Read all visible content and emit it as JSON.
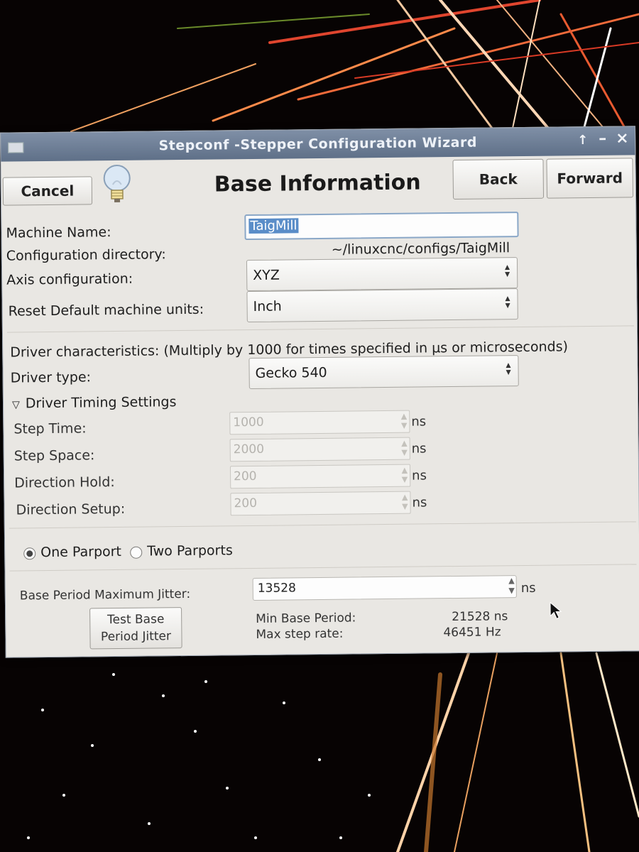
{
  "window": {
    "title": "Stepconf -Stepper Configuration Wizard",
    "controls": {
      "maximize": "↑",
      "minimize": "–",
      "close": "×"
    }
  },
  "toolbar": {
    "cancel_label": "Cancel",
    "heading": "Base Information",
    "back_label": "Back",
    "forward_label": "Forward"
  },
  "machine": {
    "name_label": "Machine Name:",
    "name_value": "TaigMill",
    "config_dir_label": "Configuration directory:",
    "config_dir_value": "~/linuxcnc/configs/TaigMill",
    "axis_label": "Axis configuration:",
    "axis_value": "XYZ",
    "units_label": "Reset Default machine units:",
    "units_value": "Inch"
  },
  "driver": {
    "characteristics_label": "Driver characteristics: (Multiply by 1000 for times specified in µs or microseconds)",
    "type_label": "Driver type:",
    "type_value": "Gecko 540",
    "timing_expander": "Driver Timing Settings",
    "timing": [
      {
        "label": "Step Time:",
        "value": "1000",
        "unit": "ns"
      },
      {
        "label": "Step Space:",
        "value": "2000",
        "unit": "ns"
      },
      {
        "label": "Direction Hold:",
        "value": "200",
        "unit": "ns"
      },
      {
        "label": "Direction Setup:",
        "value": "200",
        "unit": "ns"
      }
    ]
  },
  "parport": {
    "one_label": "One Parport",
    "two_label": "Two Parports",
    "selected": "One Parport"
  },
  "jitter": {
    "label": "Base Period Maximum Jitter:",
    "value": "13528",
    "unit": "ns",
    "test_button_label": "Test Base Period Jitter",
    "min_base_period_label": "Min Base Period:",
    "min_base_period_value": "21528 ns",
    "max_step_rate_label": "Max step rate:",
    "max_step_rate_value": "46451 Hz"
  },
  "colors": {
    "titlebar": "#6b7b93",
    "window_bg": "#e9e7e3",
    "focus_border": "#8aa7c7"
  }
}
